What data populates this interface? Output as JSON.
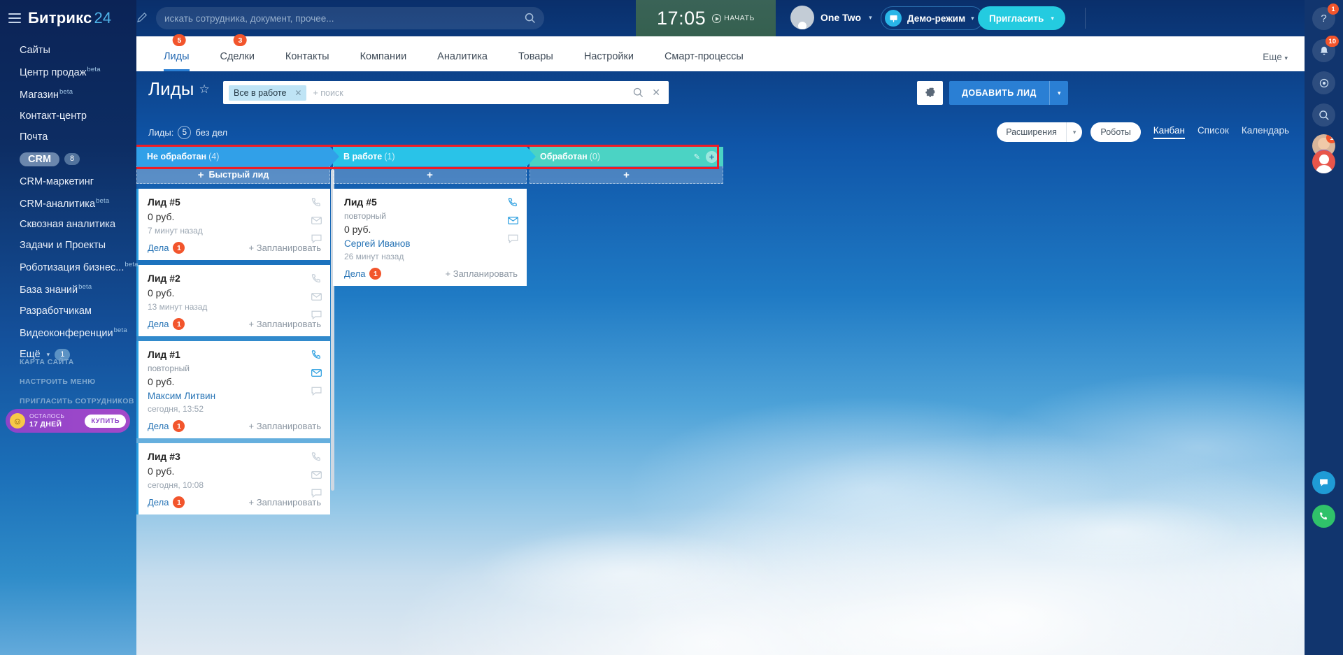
{
  "sidebar": {
    "logo": {
      "name": "Битрикс",
      "num": "24"
    },
    "items": [
      {
        "label": "Сайты",
        "beta": "",
        "badge": "",
        "active": false
      },
      {
        "label": "Центр продаж",
        "beta": "beta",
        "badge": "",
        "active": false
      },
      {
        "label": "Магазин",
        "beta": "beta",
        "badge": "",
        "active": false
      },
      {
        "label": "Контакт-центр",
        "beta": "",
        "badge": "",
        "active": false
      },
      {
        "label": "Почта",
        "beta": "",
        "badge": "",
        "active": false
      },
      {
        "label": "CRM",
        "beta": "",
        "badge": "8",
        "active": true
      },
      {
        "label": "CRM-маркетинг",
        "beta": "",
        "badge": "",
        "active": false
      },
      {
        "label": "CRM-аналитика",
        "beta": "beta",
        "badge": "",
        "active": false
      },
      {
        "label": "Сквозная аналитика",
        "beta": "",
        "badge": "",
        "active": false
      },
      {
        "label": "Задачи и Проекты",
        "beta": "",
        "badge": "",
        "active": false
      },
      {
        "label": "Роботизация бизнес...",
        "beta": "beta",
        "badge": "",
        "active": false
      },
      {
        "label": "База знаний",
        "beta": "beta",
        "badge": "",
        "active": false
      },
      {
        "label": "Разработчикам",
        "beta": "",
        "badge": "",
        "active": false
      },
      {
        "label": "Видеоконференции",
        "beta": "beta",
        "badge": "",
        "active": false
      },
      {
        "label": "Ещё",
        "beta": "",
        "badge": "1",
        "active": false,
        "caret": true
      }
    ],
    "footer_links": [
      "КАРТА САЙТА",
      "НАСТРОИТЬ МЕНЮ",
      "ПРИГЛАСИТЬ СОТРУДНИКОВ"
    ],
    "promo": {
      "line1": "ОСТАЛОСЬ",
      "line2": "17 ДНЕЙ",
      "button": "КУПИТЬ"
    }
  },
  "topbar": {
    "search_placeholder": "искать сотрудника, документ, прочее...",
    "clock": {
      "time": "17:05",
      "start_label": "НАЧАТЬ"
    },
    "user_name": "One Two",
    "demo_label": "Демо-режим",
    "invite_label": "Пригласить"
  },
  "rail": {
    "help_badge": "1",
    "notify_badge": "10",
    "avatar_badge": "1"
  },
  "tabs": {
    "items": [
      {
        "label": "Лиды",
        "badge": "5",
        "active": true
      },
      {
        "label": "Сделки",
        "badge": "3",
        "active": false
      },
      {
        "label": "Контакты",
        "badge": "",
        "active": false
      },
      {
        "label": "Компании",
        "badge": "",
        "active": false
      },
      {
        "label": "Аналитика",
        "badge": "",
        "active": false
      },
      {
        "label": "Товары",
        "badge": "",
        "active": false
      },
      {
        "label": "Настройки",
        "badge": "",
        "active": false
      },
      {
        "label": "Смарт-процессы",
        "badge": "",
        "active": false
      }
    ],
    "more": "Еще"
  },
  "page": {
    "title": "Лиды",
    "filter_chip": "Все в работе",
    "filter_placeholder": "+ поиск",
    "add_button": "ДОБАВИТЬ ЛИД",
    "count_label": "Лиды:",
    "count_value": "5",
    "count_suffix": "без дел",
    "extensions": "Расширения",
    "robots": "Роботы",
    "views": [
      {
        "label": "Канбан",
        "active": true
      },
      {
        "label": "Список",
        "active": false
      },
      {
        "label": "Календарь",
        "active": false
      }
    ]
  },
  "kanban": {
    "columns": [
      {
        "name": "Не обработан",
        "count": "(4)",
        "color": "#31a0e8",
        "add_label": "Быстрый лид",
        "cards": [
          {
            "title": "Лид #5",
            "subtitle": "",
            "sum": "0 руб.",
            "person": "",
            "time": "7 минут назад",
            "deals_label": "Дела",
            "deals_count": "1",
            "plan_label": "+ Запланировать",
            "selected": true
          },
          {
            "title": "Лид #2",
            "subtitle": "",
            "sum": "0 руб.",
            "person": "",
            "time": "13 минут назад",
            "deals_label": "Дела",
            "deals_count": "1",
            "plan_label": "+ Запланировать",
            "selected": true
          },
          {
            "title": "Лид #1",
            "subtitle": "повторный",
            "sum": "0 руб.",
            "person": "Максим Литвин",
            "time": "сегодня, 13:52",
            "deals_label": "Дела",
            "deals_count": "1",
            "plan_label": "+ Запланировать",
            "selected": true
          },
          {
            "title": "Лид #3",
            "subtitle": "",
            "sum": "0 руб.",
            "person": "",
            "time": "сегодня, 10:08",
            "deals_label": "Дела",
            "deals_count": "1",
            "plan_label": "+ Запланировать",
            "selected": true
          }
        ]
      },
      {
        "name": "В работе",
        "count": "(1)",
        "color": "#29c3e8",
        "add_label": "",
        "cards": [
          {
            "title": "Лид #5",
            "subtitle": "повторный",
            "sum": "0 руб.",
            "person": "Сергей Иванов",
            "time": "26 минут назад",
            "deals_label": "Дела",
            "deals_count": "1",
            "plan_label": "+ Запланировать",
            "selected": false
          }
        ]
      },
      {
        "name": "Обработан",
        "count": "(0)",
        "color": "#4bd3c4",
        "add_label": "",
        "cards": []
      }
    ]
  }
}
